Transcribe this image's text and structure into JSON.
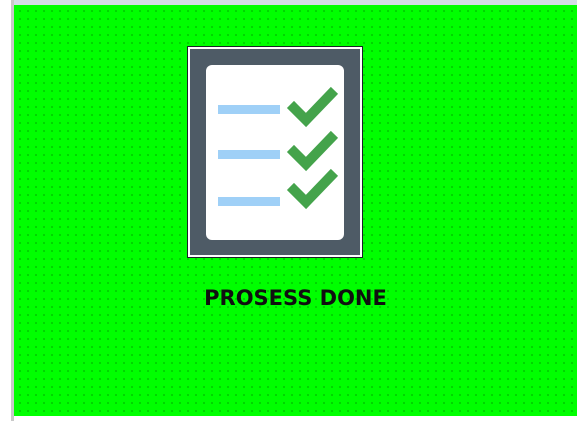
{
  "status": {
    "label": "PROSESS DONE",
    "icon": "checklist-icon"
  },
  "colors": {
    "background": "#00ff00",
    "icon_frame": "#4e5b66",
    "line": "#9fd0f7",
    "check": "#44a34b",
    "text": "#101010"
  }
}
